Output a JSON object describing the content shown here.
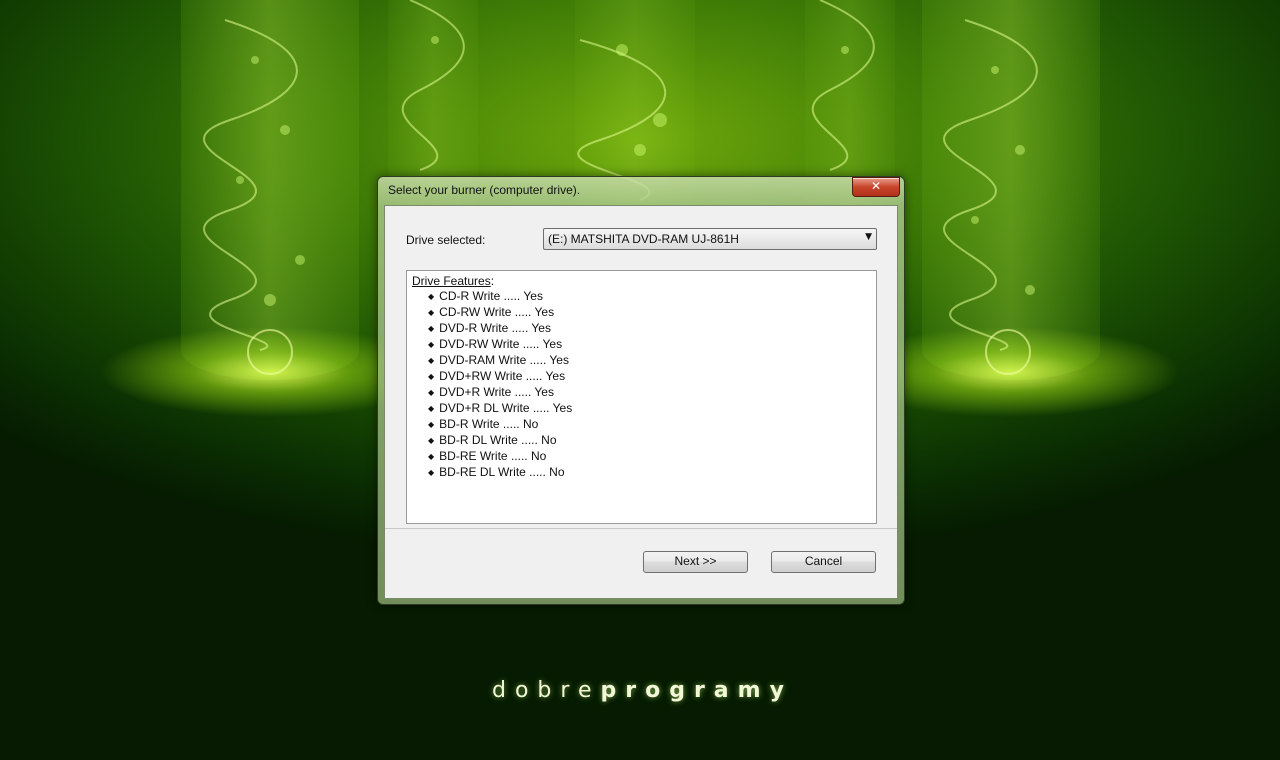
{
  "wallpaper": {
    "brand_light": "dobre",
    "brand_bold": "programy"
  },
  "dialog": {
    "title": "Select your burner (computer drive).",
    "close_glyph": "✕",
    "drive_label": "Drive selected:",
    "drive_value": "(E:) MATSHITA DVD-RAM UJ-861H",
    "features_heading": "Drive Features",
    "features_colon": ":",
    "features": [
      "CD-R Write ..... Yes",
      "CD-RW Write ..... Yes",
      "DVD-R Write ..... Yes",
      "DVD-RW Write ..... Yes",
      "DVD-RAM Write ..... Yes",
      "DVD+RW Write ..... Yes",
      "DVD+R Write ..... Yes",
      "DVD+R DL Write ..... Yes",
      "BD-R Write ..... No",
      "BD-R DL Write ..... No",
      "BD-RE Write ..... No",
      "BD-RE DL Write ..... No"
    ],
    "next_label": "Next >>",
    "cancel_label": "Cancel"
  },
  "colors": {
    "accent": "#6fa90b",
    "close": "#c8452b"
  }
}
